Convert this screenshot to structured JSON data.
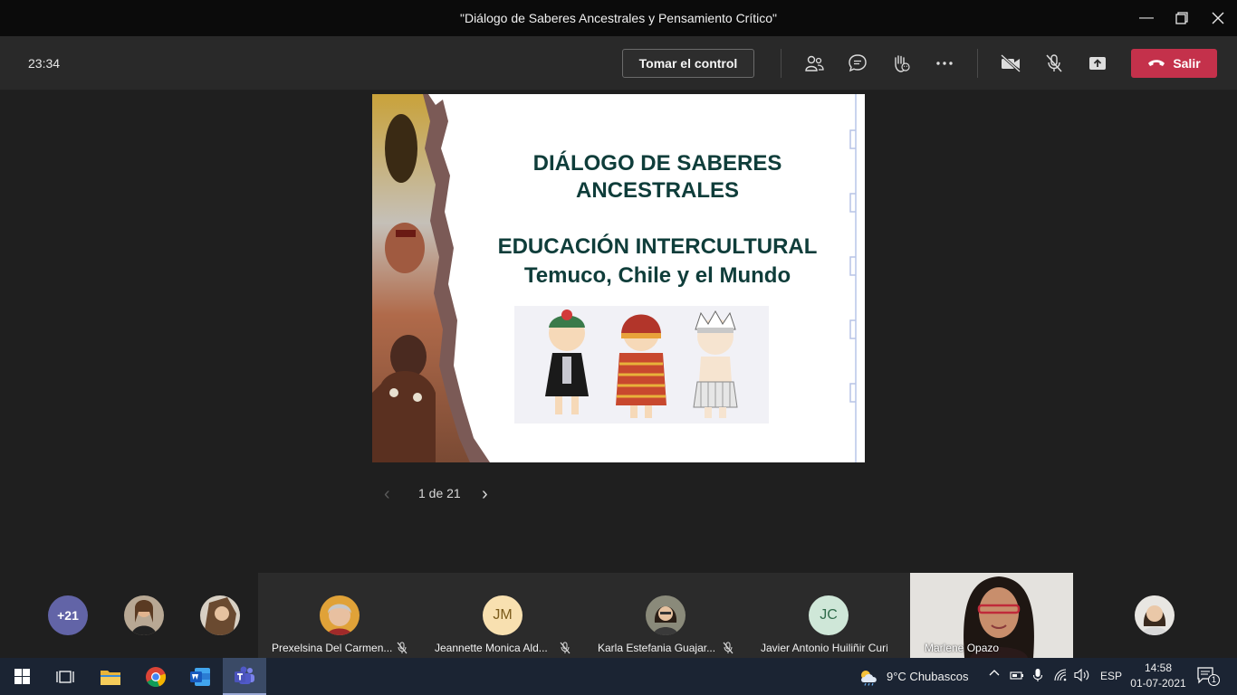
{
  "window": {
    "title": "\"Diálogo de Saberes Ancestrales y Pensamiento Crítico\"",
    "controls": [
      "minimize-icon",
      "restore-icon",
      "close-icon"
    ]
  },
  "toolbar": {
    "timer": "23:34",
    "take_control_label": "Tomar el control",
    "icons": [
      "participants-icon",
      "chat-icon",
      "raise-hand-icon",
      "more-icon",
      "camera-off-icon",
      "mic-off-icon",
      "share-icon"
    ],
    "leave_label": "Salir",
    "leave_color": "#c4314b"
  },
  "slide": {
    "title_line1": "DIÁLOGO DE SABERES",
    "title_line2": "ANCESTRALES",
    "subtitle_line1": "EDUCACIÓN INTERCULTURAL",
    "subtitle_line2": "Temuco, Chile y el Mundo",
    "text_color": "#0f3d3a"
  },
  "pager": {
    "label": "1 de 21"
  },
  "participants": {
    "overflow_count": "+21",
    "tiles": [
      {
        "name": "Prexelsina Del Carmen...",
        "initials": "",
        "muted": true
      },
      {
        "name": "Jeannette Monica Ald...",
        "initials": "JM",
        "muted": true
      },
      {
        "name": "Karla Estefania Guajar...",
        "initials": "",
        "muted": true
      },
      {
        "name": "Javier Antonio Huiliñir Curío",
        "initials": "JC",
        "muted": false
      }
    ],
    "video": {
      "name": "Marlene Opazo"
    }
  },
  "taskbar": {
    "weather": "9°C  Chubascos",
    "language": "ESP",
    "time": "14:58",
    "date": "01-07-2021",
    "notifications": "1"
  }
}
